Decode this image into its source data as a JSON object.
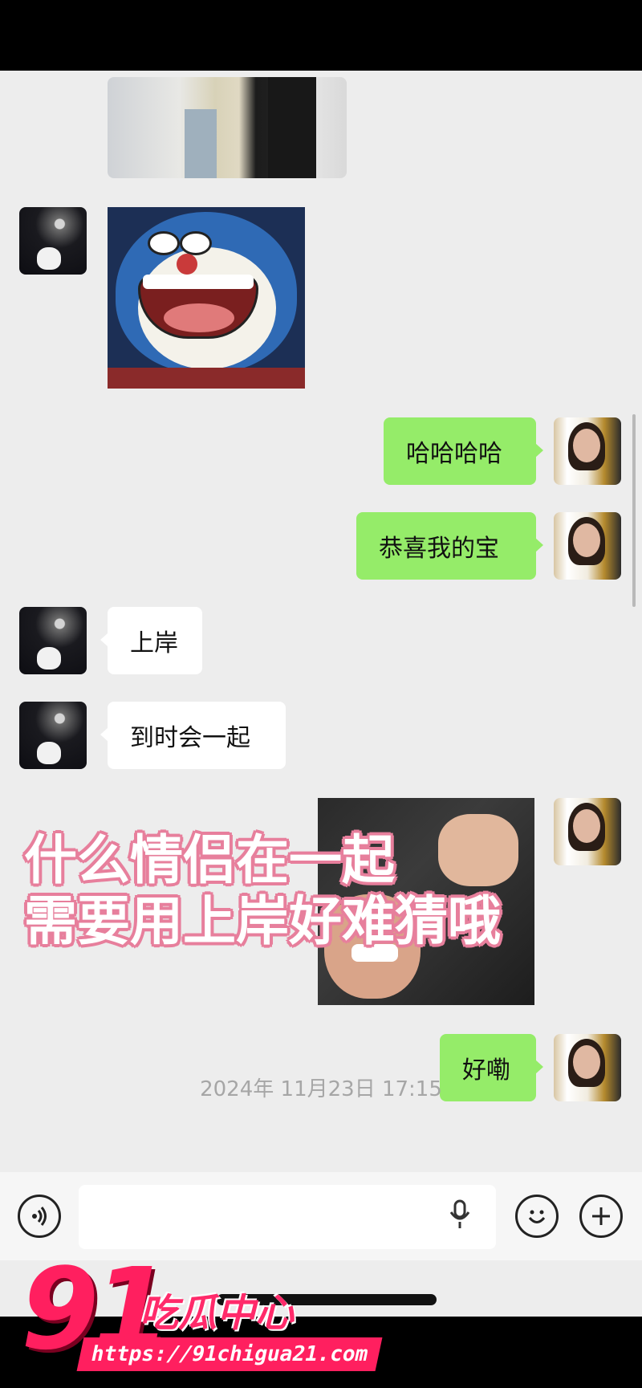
{
  "messages": {
    "right_haha": "哈哈哈哈",
    "right_congrats": "恭喜我的宝",
    "left_shangan": "上岸",
    "left_together": "到时会一起",
    "right_ok": "好嘞"
  },
  "sticker": {
    "line1": "什么情侣在一起",
    "line2": "需要用上岸好难猜哦"
  },
  "timestamp": "2024年 11月23日 17:15",
  "input_bar": {
    "voice_icon": "voice-icon",
    "mic_icon": "microphone-icon",
    "emoji_icon": "emoji-icon",
    "plus_icon": "plus-icon"
  },
  "watermark": {
    "number": "91",
    "title": "吃瓜中心",
    "url": "https://91chigua21.com"
  },
  "colors": {
    "green_bubble": "#95ec69",
    "white_bubble": "#ffffff",
    "background": "#ededed",
    "watermark_pink": "#ff1f5f"
  }
}
